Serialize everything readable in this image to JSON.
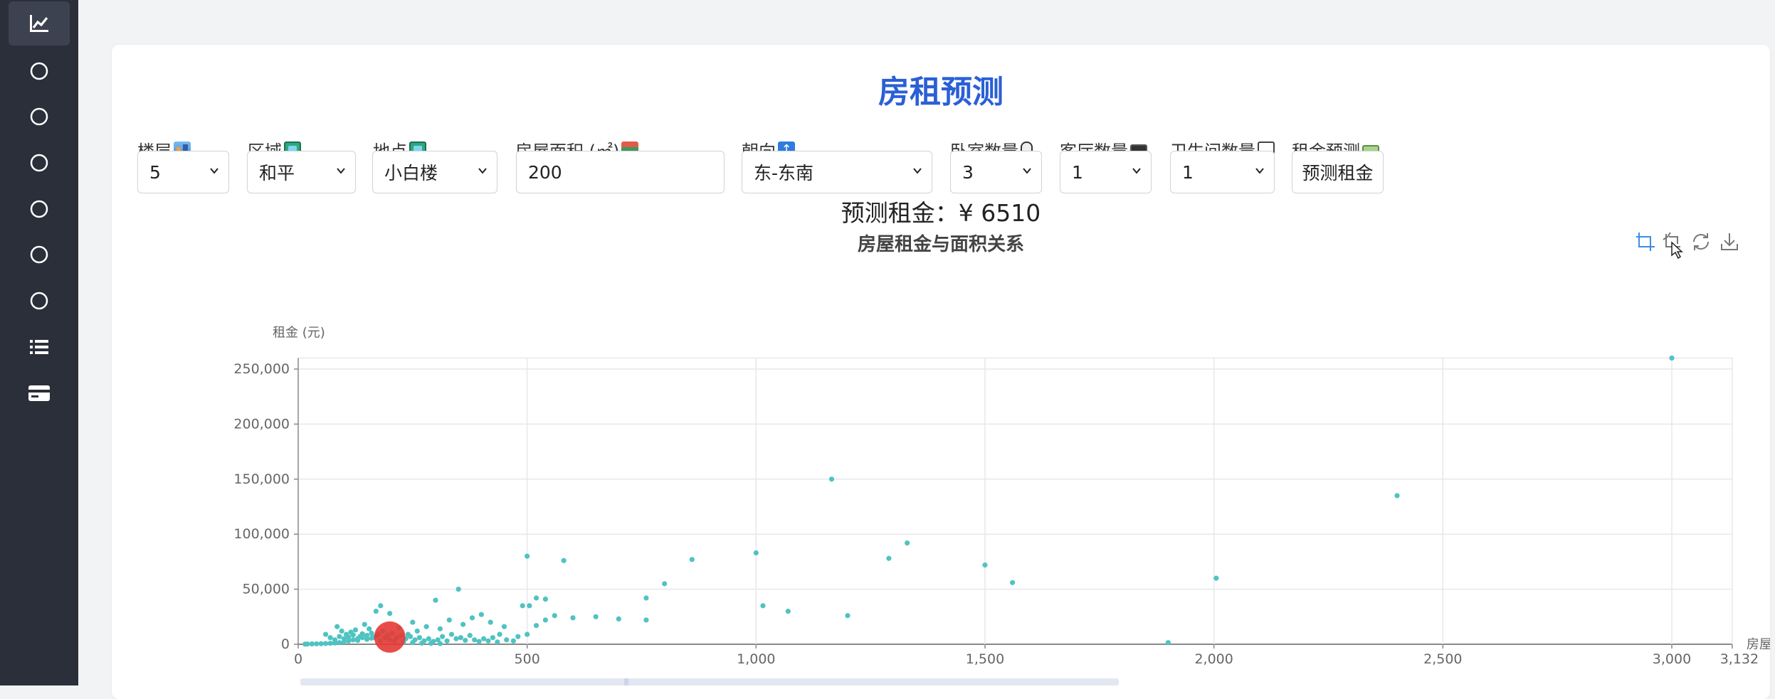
{
  "sidebar": {
    "items": [
      {
        "icon": "chart-line-icon",
        "active": true
      },
      {
        "icon": "circle-icon"
      },
      {
        "icon": "circle-icon"
      },
      {
        "icon": "circle-icon"
      },
      {
        "icon": "circle-icon"
      },
      {
        "icon": "circle-icon"
      },
      {
        "icon": "circle-icon"
      },
      {
        "icon": "list-icon"
      },
      {
        "icon": "card-icon"
      }
    ]
  },
  "page": {
    "title": "房租预测"
  },
  "form": {
    "floor": {
      "label": "楼层",
      "value": "5",
      "icon": "building-icon"
    },
    "district": {
      "label": "区域",
      "value": "和平",
      "icon": "map-book-icon"
    },
    "location": {
      "label": "地点",
      "value": "小白楼",
      "icon": "map-book-icon"
    },
    "area": {
      "label": "房屋面积 (㎡)",
      "value": "200",
      "icon": "books-icon"
    },
    "orientation": {
      "label": "朝向",
      "value": "东-东南",
      "icon": "arrow-up-icon"
    },
    "bedrooms": {
      "label": "卧室数量",
      "value": "3",
      "icon": "mouse-icon"
    },
    "livingrooms": {
      "label": "客厅数量",
      "value": "1",
      "icon": "monitor-icon"
    },
    "bathrooms": {
      "label": "卫生间数量",
      "value": "1",
      "icon": "toilet-icon"
    },
    "predict": {
      "label": "租金预测",
      "button": "预测租金",
      "icon": "money-icon"
    }
  },
  "result": {
    "text": "预测租金：¥ 6510"
  },
  "toolbox": [
    "zoom-select-icon",
    "zoom-reset-icon",
    "restore-icon",
    "download-icon"
  ],
  "colors": {
    "accent": "#2a5fd6",
    "point": "#4fc3c2",
    "highlight": "#e53935",
    "sidebar": "#2b2f3a"
  },
  "chart_data": {
    "type": "scatter",
    "title": "房屋租金与面积关系",
    "ylabel": "租金 (元)",
    "xlabel": "房屋面积 (㎡)",
    "xlim": [
      0,
      3132
    ],
    "ylim": [
      0,
      260000
    ],
    "x_ticks": [
      "0",
      "500",
      "1,000",
      "1,500",
      "2,000",
      "2,500",
      "3,000",
      "3,132"
    ],
    "y_ticks": [
      "0",
      "50,000",
      "100,000",
      "150,000",
      "200,000",
      "250,000"
    ],
    "series": [
      {
        "color": "#4fc3c2",
        "points": [
          [
            3000,
            260000
          ],
          [
            1165,
            150000
          ],
          [
            2400,
            135000
          ],
          [
            1330,
            92000
          ],
          [
            1290,
            78000
          ],
          [
            500,
            80000
          ],
          [
            580,
            76000
          ],
          [
            860,
            77000
          ],
          [
            1000,
            83000
          ],
          [
            1500,
            72000
          ],
          [
            1560,
            56000
          ],
          [
            2005,
            60000
          ],
          [
            350,
            50000
          ],
          [
            800,
            55000
          ],
          [
            520,
            42000
          ],
          [
            540,
            41000
          ],
          [
            1015,
            35000
          ],
          [
            1070,
            30000
          ],
          [
            1200,
            26000
          ],
          [
            1900,
            1500
          ],
          [
            490,
            35000
          ],
          [
            505,
            35000
          ],
          [
            760,
            22000
          ],
          [
            700,
            23000
          ],
          [
            650,
            25000
          ],
          [
            600,
            24000
          ],
          [
            560,
            26000
          ],
          [
            540,
            22000
          ],
          [
            520,
            17000
          ],
          [
            500,
            9000
          ],
          [
            760,
            42000
          ],
          [
            450,
            16000
          ],
          [
            440,
            9000
          ],
          [
            400,
            27000
          ],
          [
            420,
            20000
          ],
          [
            380,
            24000
          ],
          [
            360,
            18000
          ],
          [
            330,
            22000
          ],
          [
            300,
            40000
          ],
          [
            310,
            14000
          ],
          [
            280,
            16000
          ],
          [
            260,
            12000
          ],
          [
            250,
            20000
          ],
          [
            240,
            9000
          ],
          [
            220,
            15000
          ],
          [
            200,
            28000
          ],
          [
            180,
            35000
          ],
          [
            170,
            30000
          ],
          [
            160,
            10000
          ],
          [
            150,
            8000
          ],
          [
            140,
            6000
          ],
          [
            130,
            5000
          ],
          [
            120,
            4000
          ],
          [
            110,
            3000
          ],
          [
            100,
            2000
          ],
          [
            90,
            1500
          ],
          [
            80,
            1200
          ],
          [
            70,
            900
          ],
          [
            60,
            700
          ],
          [
            50,
            500
          ],
          [
            40,
            400
          ],
          [
            30,
            300
          ],
          [
            20,
            200
          ],
          [
            15,
            100
          ],
          [
            85,
            16000
          ],
          [
            95,
            12000
          ],
          [
            105,
            9000
          ],
          [
            115,
            11000
          ],
          [
            125,
            13000
          ],
          [
            135,
            7000
          ],
          [
            145,
            18000
          ],
          [
            155,
            14000
          ],
          [
            165,
            6000
          ],
          [
            175,
            9000
          ],
          [
            185,
            12000
          ],
          [
            195,
            8000
          ],
          [
            205,
            10000
          ],
          [
            215,
            6000
          ],
          [
            225,
            8000
          ],
          [
            235,
            5000
          ],
          [
            245,
            7000
          ],
          [
            255,
            4000
          ],
          [
            265,
            6000
          ],
          [
            275,
            3000
          ],
          [
            285,
            5000
          ],
          [
            295,
            2500
          ],
          [
            305,
            4000
          ],
          [
            315,
            7000
          ],
          [
            325,
            3000
          ],
          [
            335,
            9000
          ],
          [
            345,
            5000
          ],
          [
            355,
            6000
          ],
          [
            365,
            3500
          ],
          [
            375,
            8000
          ],
          [
            385,
            4000
          ],
          [
            395,
            2500
          ],
          [
            405,
            5000
          ],
          [
            415,
            3000
          ],
          [
            425,
            6000
          ],
          [
            435,
            2000
          ],
          [
            455,
            4000
          ],
          [
            470,
            3000
          ],
          [
            480,
            7000
          ],
          [
            60,
            9000
          ],
          [
            70,
            6000
          ],
          [
            80,
            4000
          ],
          [
            90,
            7000
          ],
          [
            100,
            5000
          ],
          [
            110,
            6500
          ],
          [
            120,
            8500
          ],
          [
            130,
            3500
          ],
          [
            140,
            9500
          ],
          [
            150,
            4500
          ],
          [
            160,
            5500
          ],
          [
            170,
            7500
          ],
          [
            180,
            3000
          ],
          [
            190,
            6000
          ],
          [
            200,
            4000
          ],
          [
            210,
            3000
          ],
          [
            230,
            2000
          ],
          [
            250,
            1500
          ],
          [
            270,
            1000
          ],
          [
            290,
            800
          ],
          [
            310,
            600
          ]
        ]
      },
      {
        "color": "#e53935",
        "points": [
          [
            200,
            6510
          ]
        ]
      }
    ]
  }
}
